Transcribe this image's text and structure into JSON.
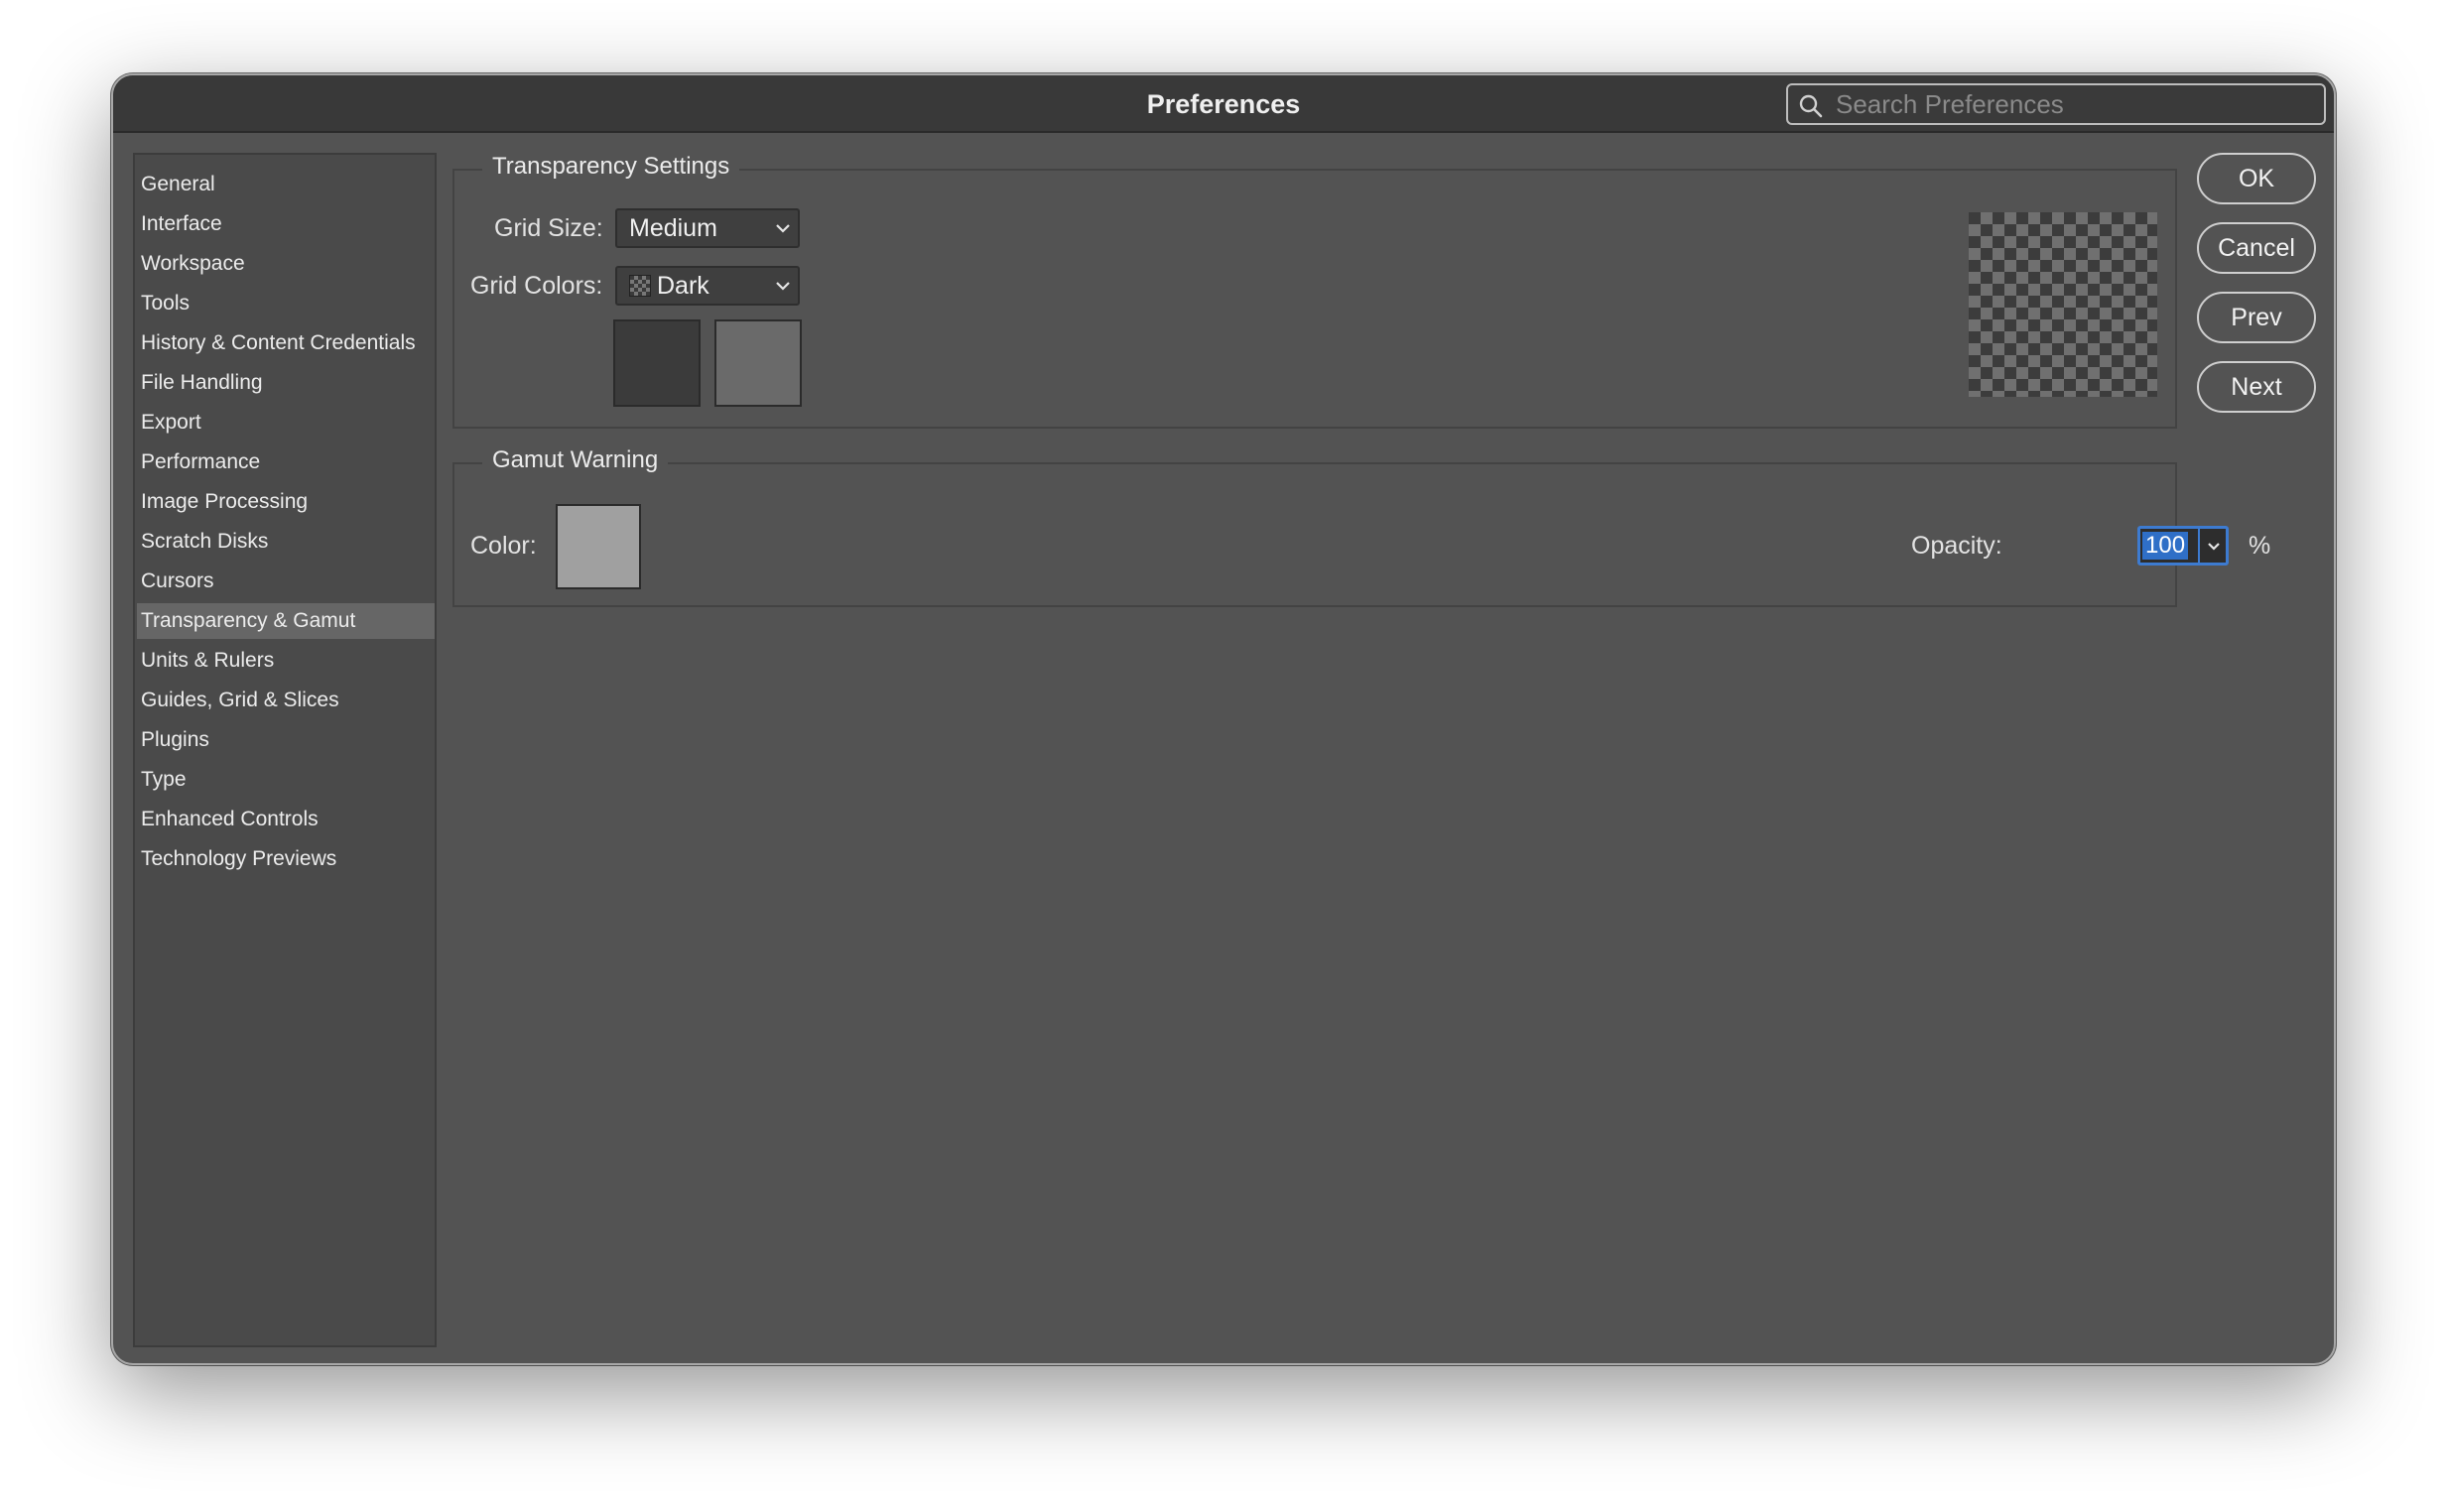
{
  "window": {
    "title": "Preferences",
    "search_placeholder": "Search Preferences"
  },
  "sidebar": {
    "selected": "Transparency & Gamut",
    "items": [
      {
        "label": "General"
      },
      {
        "label": "Interface"
      },
      {
        "label": "Workspace"
      },
      {
        "label": "Tools"
      },
      {
        "label": "History & Content Credentials"
      },
      {
        "label": "File Handling"
      },
      {
        "label": "Export"
      },
      {
        "label": "Performance"
      },
      {
        "label": "Image Processing"
      },
      {
        "label": "Scratch Disks"
      },
      {
        "label": "Cursors"
      },
      {
        "label": "Transparency & Gamut"
      },
      {
        "label": "Units & Rulers"
      },
      {
        "label": "Guides, Grid & Slices"
      },
      {
        "label": "Plugins"
      },
      {
        "label": "Type"
      },
      {
        "label": "Enhanced Controls"
      },
      {
        "label": "Technology Previews"
      }
    ]
  },
  "transparency": {
    "title": "Transparency Settings",
    "grid_size_label": "Grid Size:",
    "grid_size_value": "Medium",
    "grid_colors_label": "Grid Colors:",
    "grid_colors_value": "Dark",
    "swatch_1_color": "#3b3b3b",
    "swatch_2_color": "#6a6a6a"
  },
  "gamut": {
    "title": "Gamut Warning",
    "color_label": "Color:",
    "color_value": "#a0a0a0",
    "opacity_label": "Opacity:",
    "opacity_value": "100",
    "opacity_unit": "%"
  },
  "buttons": {
    "ok": "OK",
    "cancel": "Cancel",
    "prev": "Prev",
    "next": "Next"
  },
  "icons": {
    "search": "search-icon",
    "dropdown": "chevron-down-icon",
    "grid_colors": "checkerboard-icon"
  }
}
